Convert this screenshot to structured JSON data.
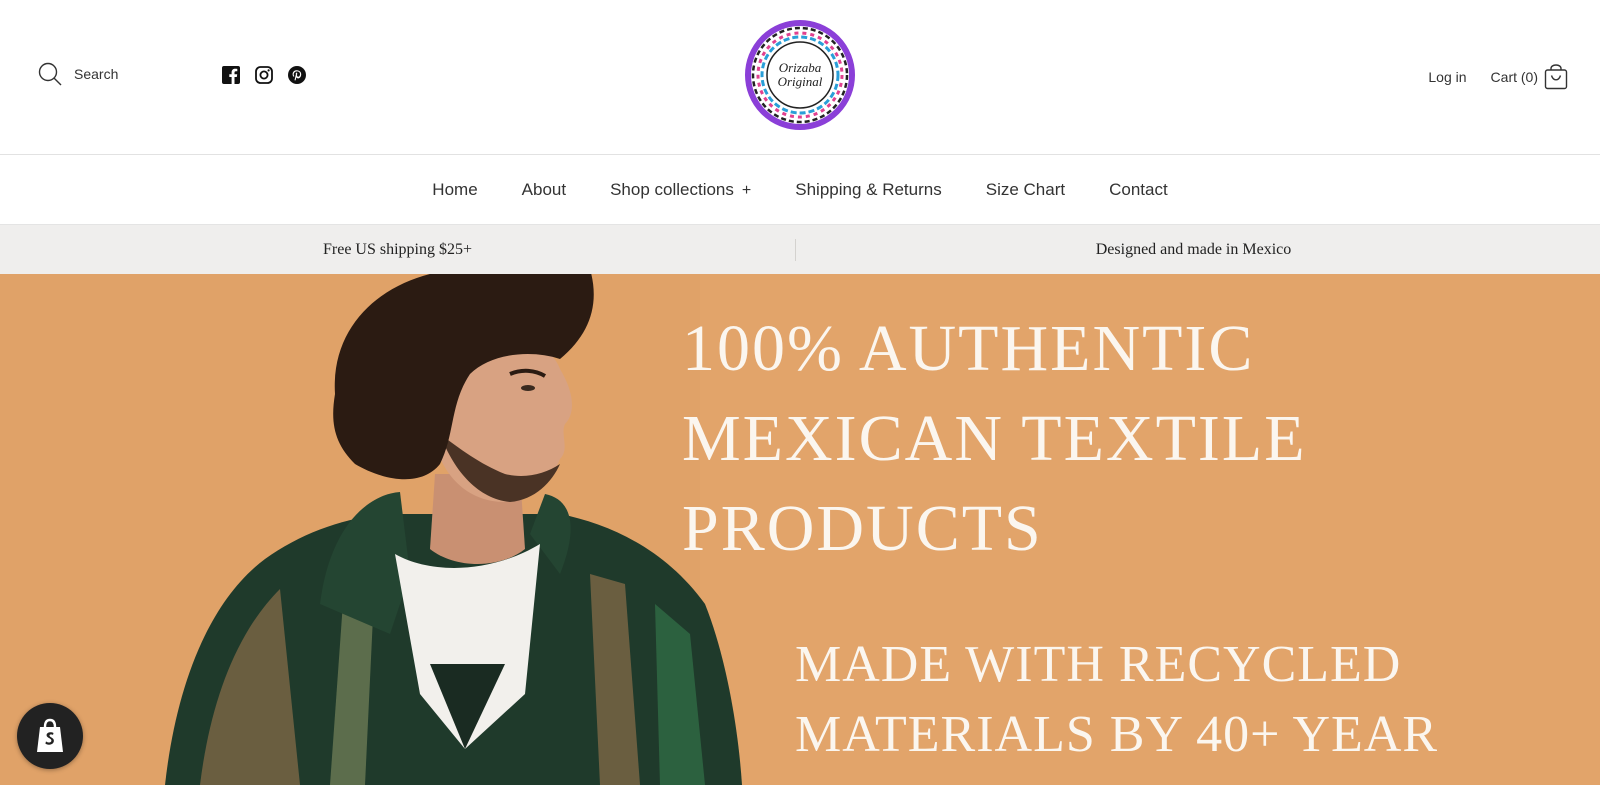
{
  "header": {
    "search_label": "Search",
    "social": [
      "facebook-icon",
      "instagram-icon",
      "pinterest-icon"
    ],
    "logo_lines": [
      "Orizaba",
      "Original"
    ],
    "login_label": "Log in",
    "cart_label": "Cart (0)"
  },
  "nav": {
    "items": [
      {
        "label": "Home"
      },
      {
        "label": "About"
      },
      {
        "label": "Shop collections",
        "suffix": "+"
      },
      {
        "label": "Shipping & Returns"
      },
      {
        "label": "Size Chart"
      },
      {
        "label": "Contact"
      }
    ]
  },
  "announcement": {
    "left": "Free US shipping $25+",
    "right": "Designed and made in Mexico"
  },
  "hero": {
    "headline": [
      "100% AUTHENTIC",
      "MEXICAN TEXTILE",
      "PRODUCTS"
    ],
    "subline": [
      "MADE WITH RECYCLED",
      "MATERIALS BY 40+ YEAR"
    ]
  },
  "badge": {
    "icon": "shopify-bag-icon"
  },
  "colors": {
    "hero_background": "#e2a46a",
    "announcement_bar": "#efeeed",
    "hero_text": "#fbf6ef"
  }
}
